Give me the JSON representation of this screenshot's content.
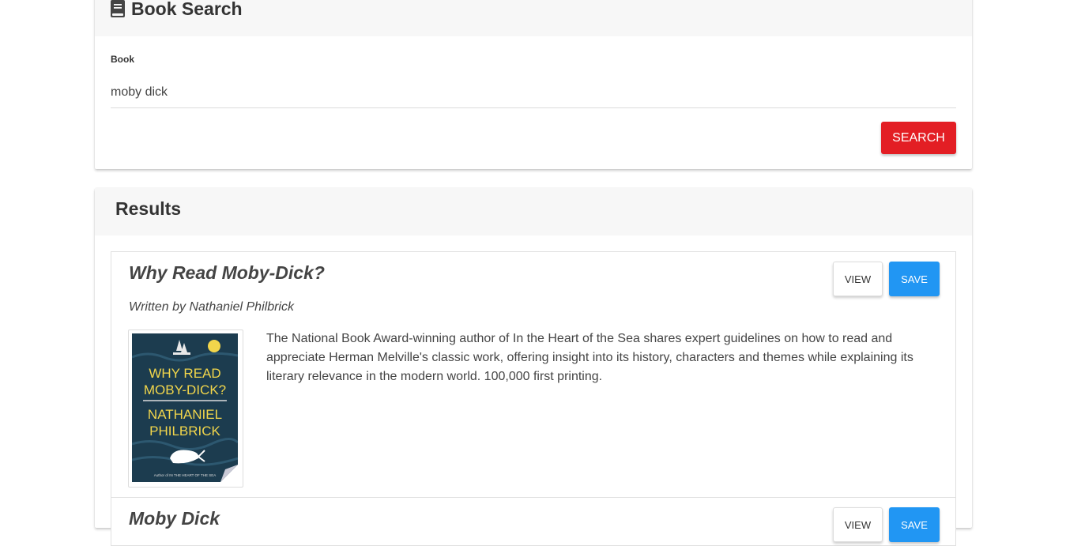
{
  "search": {
    "title": "Book Search",
    "field_label": "Book",
    "input_value": "moby dick",
    "button_label": "SEARCH"
  },
  "results": {
    "title": "Results",
    "items": [
      {
        "title": "Why Read Moby-Dick?",
        "author": "Written by Nathaniel Philbrick",
        "description": "The National Book Award-winning author of In the Heart of the Sea shares expert guidelines on how to read and appreciate Herman Melville's classic work, offering insight into its history, characters and themes while explaining its literary relevance in the modern world. 100,000 first printing.",
        "view_label": "VIEW",
        "save_label": "SAVE",
        "cover": {
          "line1": "WHY READ",
          "line2": "MOBY-DICK?",
          "line3": "NATHANIEL",
          "line4": "PHILBRICK",
          "footer": "Author of IN THE HEART OF THE SEA"
        }
      },
      {
        "title": "Moby Dick",
        "view_label": "VIEW",
        "save_label": "SAVE"
      }
    ]
  },
  "colors": {
    "search_button": "#e31e24",
    "save_button": "#2196f3",
    "header_bg": "#f7f7f7"
  }
}
